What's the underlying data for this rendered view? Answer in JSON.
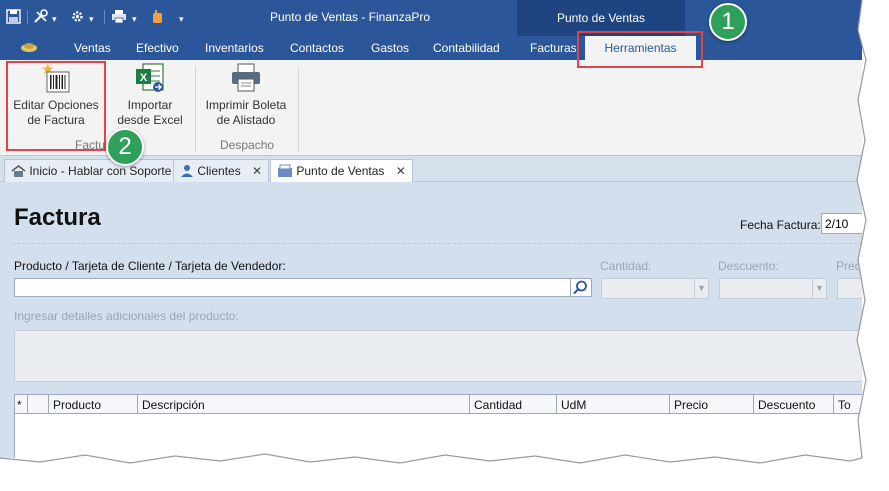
{
  "window": {
    "title": "Punto de Ventas - FinanzaPro",
    "context_tab_header": "Punto de Ventas"
  },
  "quick_access": {
    "icons": [
      "save-icon",
      "tools-icon",
      "gear-icon",
      "print-icon",
      "hand-icon",
      "customize-icon"
    ],
    "dropdown_glyph": "▾"
  },
  "ribbon_tabs": [
    "Ventas",
    "Efectivo",
    "Inventarios",
    "Contactos",
    "Gastos",
    "Contabilidad",
    "Facturas",
    "Herramientas"
  ],
  "ribbon": {
    "buttons": {
      "editar": "Editar Opciones\nde Factura",
      "importar": "Importar\ndesde Excel",
      "imprimir": "Imprimir Boleta\nde Alistado"
    },
    "groups": {
      "factura": "Factura",
      "despacho": "Despacho"
    }
  },
  "callouts": [
    "1",
    "2"
  ],
  "doc_tabs": [
    {
      "label": "Inicio - Hablar con Soporte",
      "icon": "home-icon",
      "closable": false
    },
    {
      "label": "Clientes",
      "icon": "contacts-icon",
      "closable": true
    },
    {
      "label": "Punto de Ventas",
      "icon": "pos-icon",
      "closable": true
    }
  ],
  "close_glyph": "✕",
  "form": {
    "page_title": "Factura",
    "fecha_label": "Fecha Factura:",
    "fecha_value": "2/10",
    "product_label": "Producto / Tarjeta de Cliente / Tarjeta de Vendedor:",
    "cantidad_label": "Cantidad:",
    "descuento_label": "Descuento:",
    "precio_label": "Prec",
    "details_label": "Ingresar detalles adicionales del producto:",
    "dropdown_glyph": "▼"
  },
  "grid": {
    "columns": [
      "*",
      "",
      "Producto",
      "Descripción",
      "Cantidad",
      "UdM",
      "Precio",
      "Descuento",
      "To"
    ]
  },
  "colors": {
    "title_bar": "#2b579a",
    "context_header": "#1f4480",
    "highlight_box": "#e0444a",
    "callout": "#2ea05a"
  }
}
